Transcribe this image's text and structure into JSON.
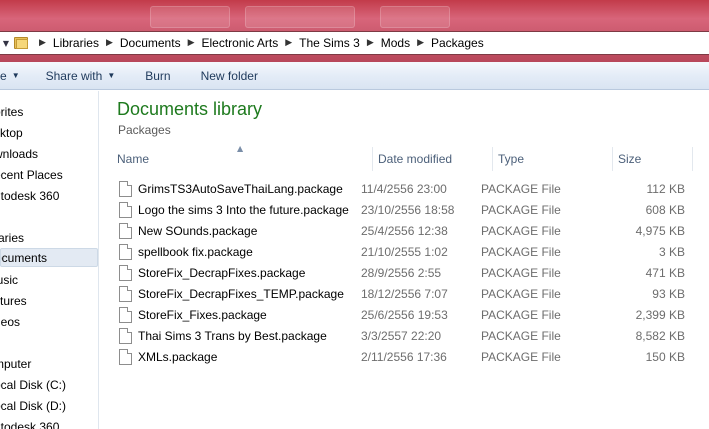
{
  "address": {
    "crumbs": [
      "Libraries",
      "Documents",
      "Electronic Arts",
      "The Sims 3",
      "Mods",
      "Packages"
    ]
  },
  "toolbar": {
    "organize_label": "e",
    "share_label": "Share with",
    "burn_label": "Burn",
    "new_folder_label": "New folder"
  },
  "nav": {
    "items": [
      {
        "label": "orites",
        "selected": false
      },
      {
        "label": "sktop",
        "selected": false
      },
      {
        "label": "wnloads",
        "selected": false
      },
      {
        "label": "ecent Places",
        "selected": false
      },
      {
        "label": "utodesk 360",
        "selected": false
      },
      {
        "label": "raries",
        "selected": false
      },
      {
        "label": "ocuments",
        "selected": true
      },
      {
        "label": "lusic",
        "selected": false
      },
      {
        "label": "ctures",
        "selected": false
      },
      {
        "label": "deos",
        "selected": false
      },
      {
        "label": "mputer",
        "selected": false
      },
      {
        "label": "ocal Disk (C:)",
        "selected": false
      },
      {
        "label": "ocal Disk (D:)",
        "selected": false
      },
      {
        "label": "utodesk 360",
        "selected": false
      }
    ]
  },
  "library": {
    "title": "Documents library",
    "subtitle": "Packages"
  },
  "columns": {
    "name": "Name",
    "date": "Date modified",
    "type": "Type",
    "size": "Size"
  },
  "files": [
    {
      "name": "GrimsTS3AutoSaveThaiLang.package",
      "date": "11/4/2556 23:00",
      "type": "PACKAGE File",
      "size": "112 KB"
    },
    {
      "name": "Logo the sims 3 Into the future.package",
      "date": "23/10/2556 18:58",
      "type": "PACKAGE File",
      "size": "608 KB"
    },
    {
      "name": "New SOunds.package",
      "date": "25/4/2556 12:38",
      "type": "PACKAGE File",
      "size": "4,975 KB"
    },
    {
      "name": "spellbook fix.package",
      "date": "21/10/2555 1:02",
      "type": "PACKAGE File",
      "size": "3 KB"
    },
    {
      "name": "StoreFix_DecrapFixes.package",
      "date": "28/9/2556 2:55",
      "type": "PACKAGE File",
      "size": "471 KB"
    },
    {
      "name": "StoreFix_DecrapFixes_TEMP.package",
      "date": "18/12/2556 7:07",
      "type": "PACKAGE File",
      "size": "93 KB"
    },
    {
      "name": "StoreFix_Fixes.package",
      "date": "25/6/2556 19:53",
      "type": "PACKAGE File",
      "size": "2,399 KB"
    },
    {
      "name": "Thai Sims 3 Trans by Best.package",
      "date": "3/3/2557 22:20",
      "type": "PACKAGE File",
      "size": "8,582 KB"
    },
    {
      "name": "XMLs.package",
      "date": "2/11/2556 17:36",
      "type": "PACKAGE File",
      "size": "150 KB"
    }
  ]
}
